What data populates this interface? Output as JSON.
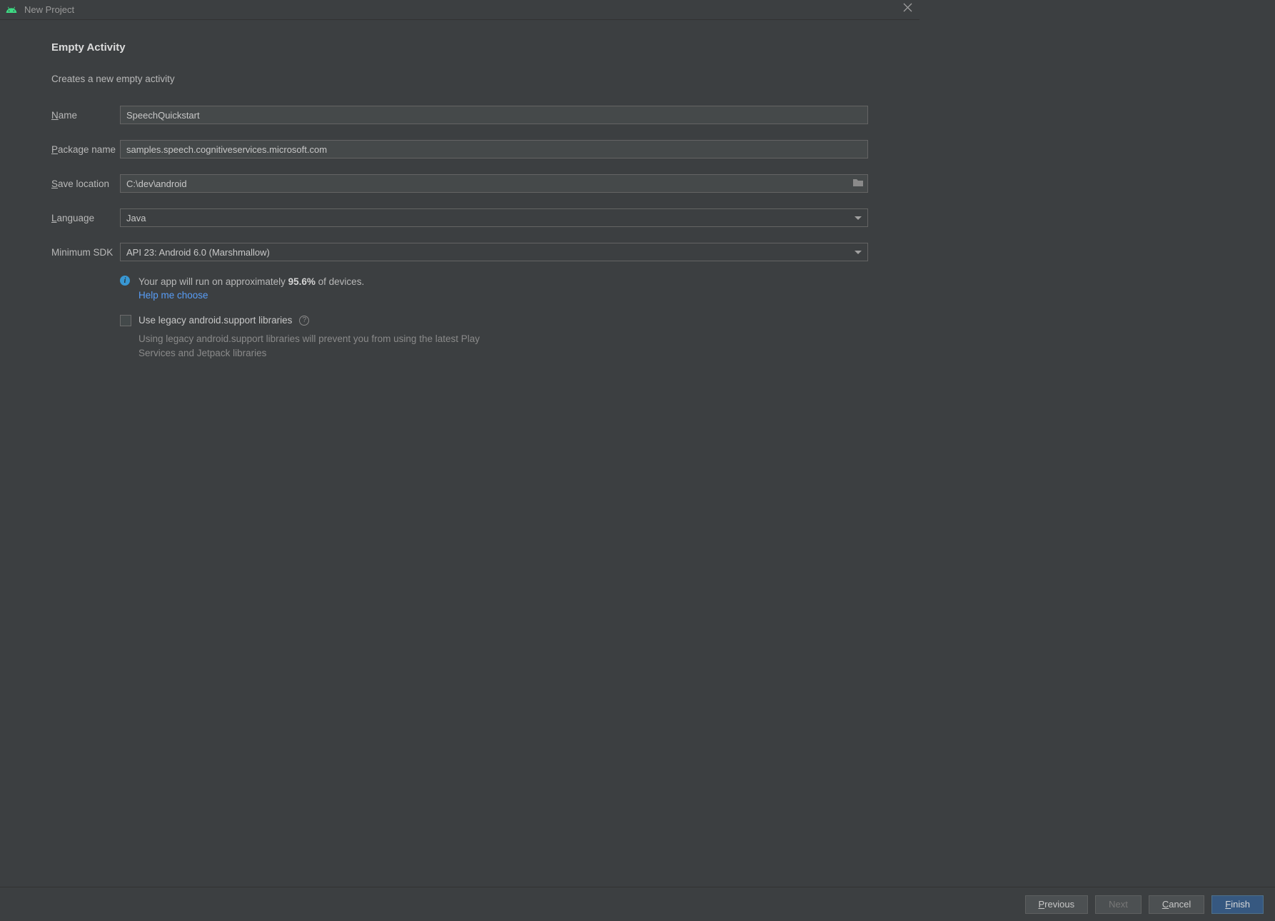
{
  "titlebar": {
    "title": "New Project"
  },
  "header": {
    "heading": "Empty Activity",
    "subtitle": "Creates a new empty activity"
  },
  "form": {
    "name_label": "Name",
    "name_value": "SpeechQuickstart",
    "package_label": "Package name",
    "package_value": "samples.speech.cognitiveservices.microsoft.com",
    "save_label": "Save location",
    "save_value": "C:\\dev\\android",
    "language_label": "Language",
    "language_value": "Java",
    "minsdk_label": "Minimum SDK",
    "minsdk_value": "API 23: Android 6.0 (Marshmallow)"
  },
  "info": {
    "prefix": "Your app will run on approximately ",
    "percent": "95.6%",
    "suffix": " of devices.",
    "help_link": "Help me choose"
  },
  "legacy": {
    "checkbox_label": "Use legacy android.support libraries",
    "description": "Using legacy android.support libraries will prevent you from using the latest Play Services and Jetpack libraries"
  },
  "footer": {
    "previous": "Previous",
    "next": "Next",
    "cancel": "Cancel",
    "finish": "Finish"
  }
}
